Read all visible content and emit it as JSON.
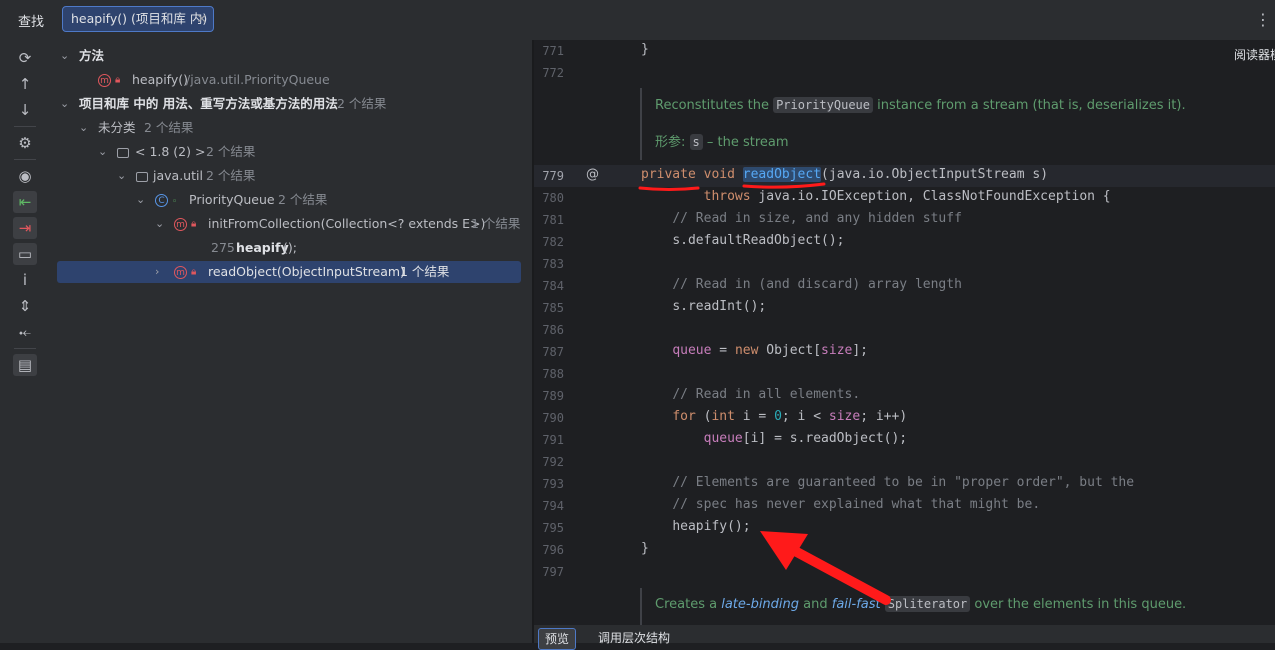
{
  "toolwindow": {
    "title": "查找",
    "tab_label": "heapify() (项目和库 内)",
    "tab_close": "✕",
    "menu": "⋮"
  },
  "left_toolbar": {
    "icons": [
      "refresh-icon",
      "arrow-up-icon",
      "arrow-down-icon",
      "settings-icon",
      "eye-icon",
      "import-icon",
      "export-icon",
      "folder-icon",
      "info-icon",
      "expand-icon",
      "collapse-icon",
      "preview-icon"
    ]
  },
  "tree": {
    "methods_header": "方法",
    "method_name": "heapify()",
    "method_path": "/java.util.PriorityQueue",
    "usages_header": "项目和库 中的 用法、重写方法或基方法的用法",
    "usages_count": "2 个结果",
    "uncategorized": "未分类",
    "uncategorized_count": "2 个结果",
    "jdk": "< 1.8 (2) >",
    "jdk_count": "2 个结果",
    "package": "java.util",
    "package_count": "2 个结果",
    "class_name": "PriorityQueue",
    "class_count": "2 个结果",
    "method1": "initFromCollection(Collection<? extends E>)",
    "method1_count": "1 个结果",
    "usage_line_num": "275",
    "usage_line_code": "heapify",
    "usage_line_suffix": "();",
    "method2": "readObject(ObjectInputStream)",
    "method2_count": "1 个结果"
  },
  "editor": {
    "reader_mode": "阅读器模式",
    "doc1_pre": "Reconstitutes the ",
    "doc1_code": "PriorityQueue",
    "doc1_post": " instance from a stream (that is, deserializes it).",
    "doc2_label": "形参:",
    "doc2_code": "s",
    "doc2_text": " – the stream",
    "doc3_pre": "Creates a ",
    "doc3_link1": "late-binding",
    "doc3_mid": " and ",
    "doc3_link2": "fail-fast",
    "doc3_code": "Spliterator",
    "doc3_post": " over the elements in this queue.",
    "gutter_annotation": "@",
    "line_numbers": [
      "771",
      "772",
      "779",
      "780",
      "781",
      "782",
      "783",
      "784",
      "785",
      "786",
      "787",
      "788",
      "789",
      "790",
      "791",
      "792",
      "793",
      "794",
      "795",
      "796",
      "797"
    ],
    "tok": {
      "brace_close": "}",
      "private": "private",
      "void": "void",
      "readObject": "readObject",
      "sig_rest": "(java.io.ObjectInputStream s)",
      "throws": "throws",
      "throws_rest": " java.io.IOException, ClassNotFoundException {",
      "c781": "// Read in size, and any hidden stuff",
      "l782": "s.defaultReadObject();",
      "c784": "// Read in (and discard) array length",
      "l785": "s.readInt();",
      "queue": "queue",
      "l787_mid": " = ",
      "new": "new",
      "l787_obj": " Object[",
      "size": "size",
      "l787_end": "];",
      "c789": "// Read in all elements.",
      "for": "for",
      "l790_a": " (",
      "int": "int",
      "l790_b": " i = ",
      "zero": "0",
      "l790_c": "; i < ",
      "l790_d": "; i++)",
      "l791_b": "[i] = s.readObject();",
      "c793": "// Elements are guaranteed to be in \"proper order\", but the",
      "c794": "// spec has never explained what that might be.",
      "l795": "heapify();"
    }
  },
  "bottom_tabs": {
    "preview": "预览",
    "hierarchy": "调用层次结构"
  },
  "colors": {
    "accent": "#4e79c7",
    "annotation_red": "#ff1a1a",
    "selection": "#2e436e"
  }
}
